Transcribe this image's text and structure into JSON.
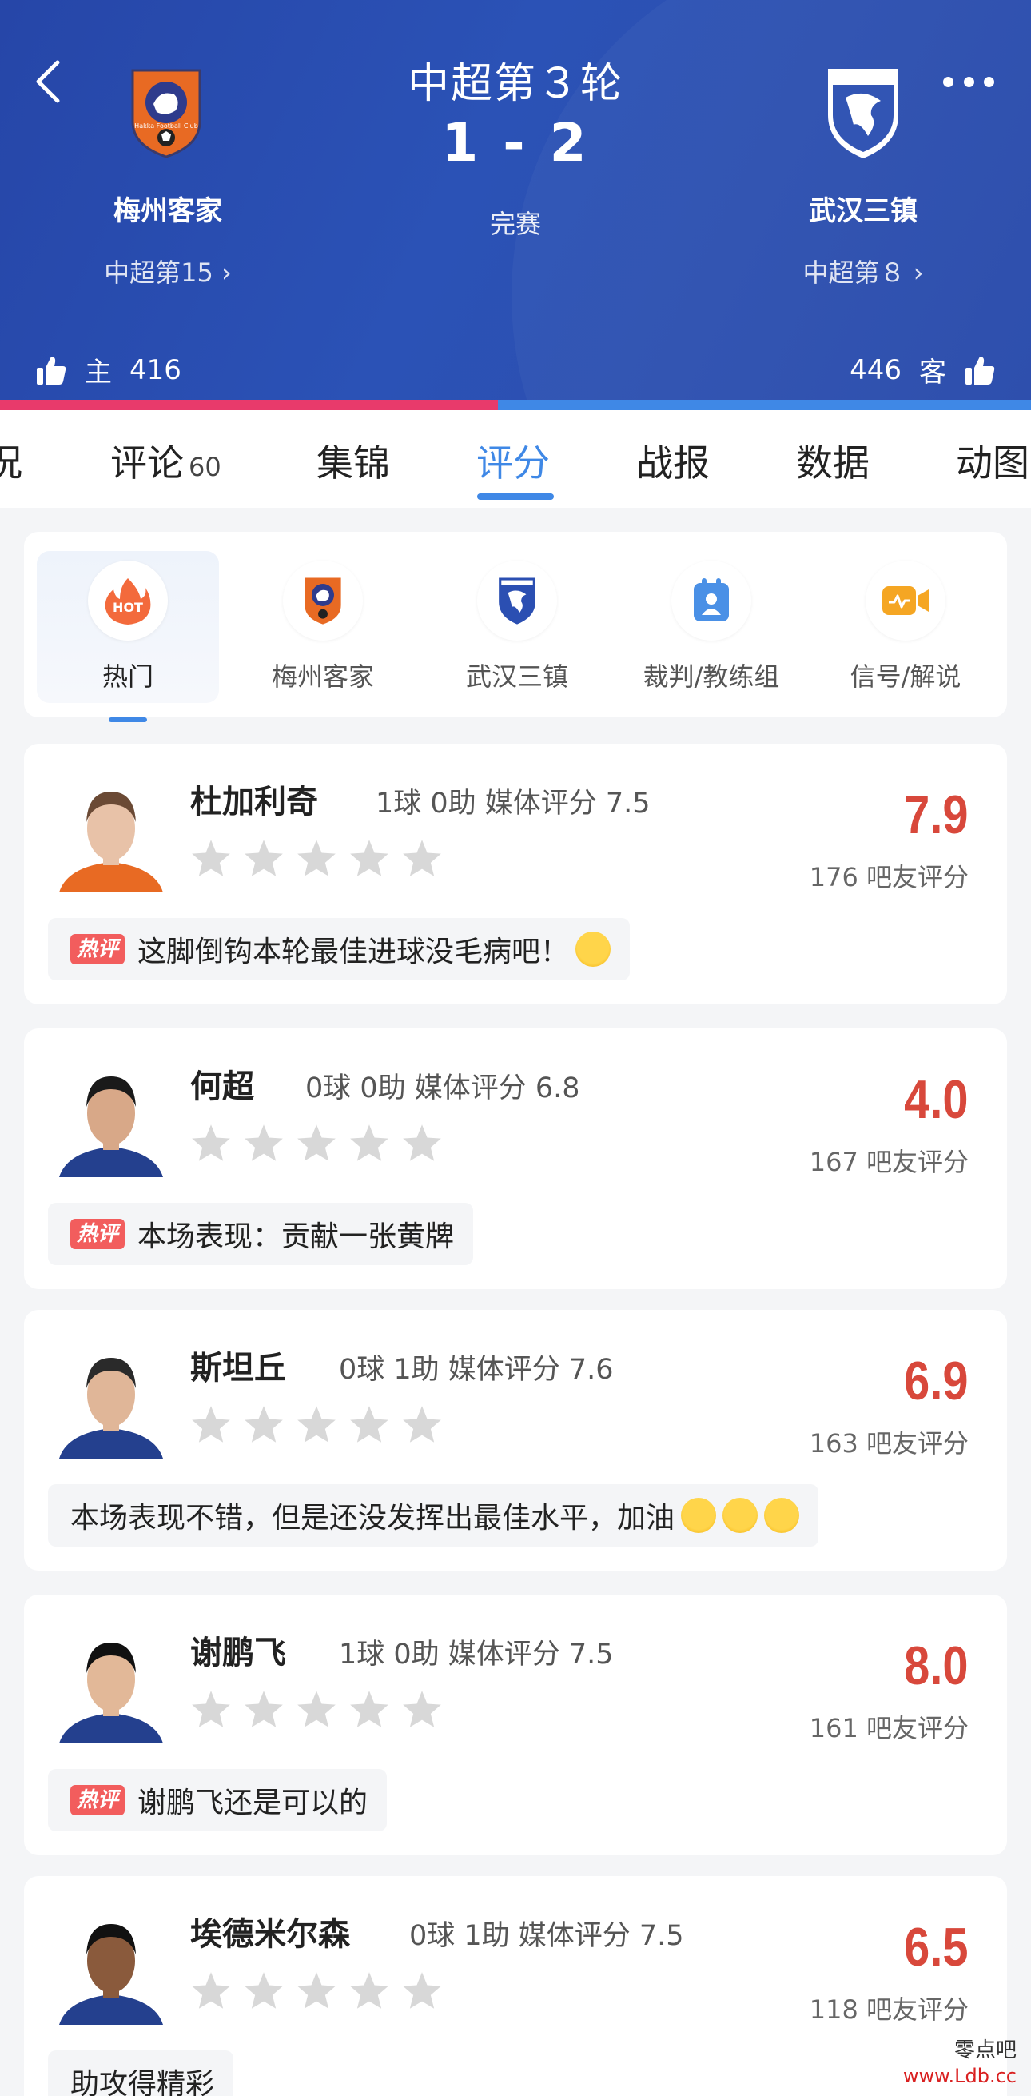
{
  "header": {
    "round": "中超第３轮",
    "score": "1 - 2",
    "status": "完赛",
    "home": {
      "name": "梅州客家",
      "rank": "中超第15",
      "vote_label": "主",
      "votes": "416"
    },
    "away": {
      "name": "武汉三镇",
      "rank": "中超第８",
      "vote_label": "客",
      "votes": "446"
    },
    "home_vote_share": 0.483,
    "colors": {
      "home": "#e83a6b",
      "away": "#3f88e6",
      "header": "#2b4fb2"
    }
  },
  "tabs": [
    {
      "label": "况"
    },
    {
      "label": "评论",
      "count": "60"
    },
    {
      "label": "集锦"
    },
    {
      "label": "评分",
      "active": true
    },
    {
      "label": "战报"
    },
    {
      "label": "数据"
    },
    {
      "label": "动图"
    }
  ],
  "filters": [
    {
      "label": "热门",
      "icon": "hot-icon",
      "icon_text": "HOT",
      "active": true
    },
    {
      "label": "梅州客家",
      "icon": "meizhou-logo-icon"
    },
    {
      "label": "武汉三镇",
      "icon": "wuhan-logo-icon"
    },
    {
      "label": "裁判/教练组",
      "icon": "referee-badge-icon"
    },
    {
      "label": "信号/解说",
      "icon": "video-camera-icon"
    }
  ],
  "hot_badge": "热评",
  "players": [
    {
      "name": "杜加利奇",
      "stats": "1球 0助  媒体评分 7.5",
      "rating": "7.9",
      "voters": "176 吧友评分",
      "comment": "这脚倒钩本轮最佳进球没毛病吧！",
      "hot": true,
      "emojis": 1,
      "stars": 0
    },
    {
      "name": "何超",
      "stats": "0球 0助  媒体评分 6.8",
      "rating": "4.0",
      "voters": "167 吧友评分",
      "comment": "本场表现：贡献一张黄牌",
      "hot": true,
      "emojis": 0,
      "stars": 0
    },
    {
      "name": "斯坦丘",
      "stats": "0球 1助  媒体评分 7.6",
      "rating": "6.9",
      "voters": "163 吧友评分",
      "comment": "本场表现不错，但是还没发挥出最佳水平，加油",
      "hot": false,
      "emojis": 3,
      "stars": 0
    },
    {
      "name": "谢鹏飞",
      "stats": "1球 0助  媒体评分 7.5",
      "rating": "8.0",
      "voters": "161 吧友评分",
      "comment": "谢鹏飞还是可以的",
      "hot": true,
      "emojis": 0,
      "stars": 0
    },
    {
      "name": "埃德米尔森",
      "stats": "0球 1助  媒体评分 7.5",
      "rating": "6.5",
      "voters": "118 吧友评分",
      "comment": "助攻得精彩",
      "hot": false,
      "emojis": 0,
      "stars": 0
    }
  ],
  "watermark": {
    "name": "零点吧",
    "url": "www.Ldb.cc"
  }
}
